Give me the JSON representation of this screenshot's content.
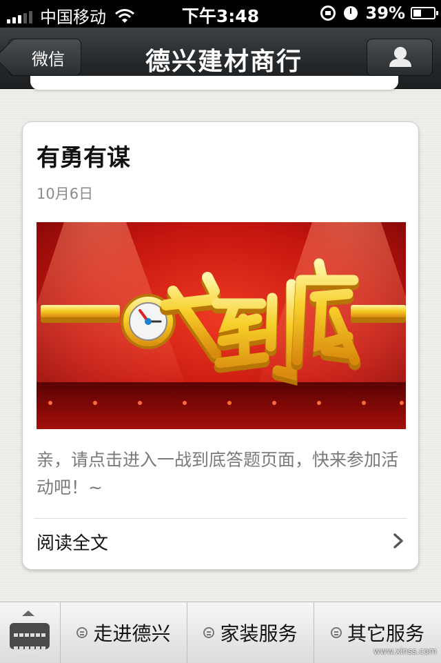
{
  "status_bar": {
    "carrier": "中国移动",
    "time": "下午3:48",
    "battery": "39%",
    "battery_level": 0.39
  },
  "nav": {
    "back_label": "微信",
    "title": "德兴建材商行",
    "profile_icon": "person-icon"
  },
  "article": {
    "title": "有勇有谋",
    "date": "10月6日",
    "banner_text": "一战到底",
    "description": "亲，请点击进入一战到底答题页面，快来参加活动吧！~",
    "read_more": "阅读全文"
  },
  "bottom_menu": {
    "keyboard_icon": "keyboard-icon",
    "items": [
      "走进德兴",
      "家装服务",
      "其它服务"
    ]
  },
  "watermark": "www.xinss.com",
  "colors": {
    "navbar": "#25282a",
    "banner_red": "#c4150f",
    "banner_gold": "#f5c518"
  }
}
